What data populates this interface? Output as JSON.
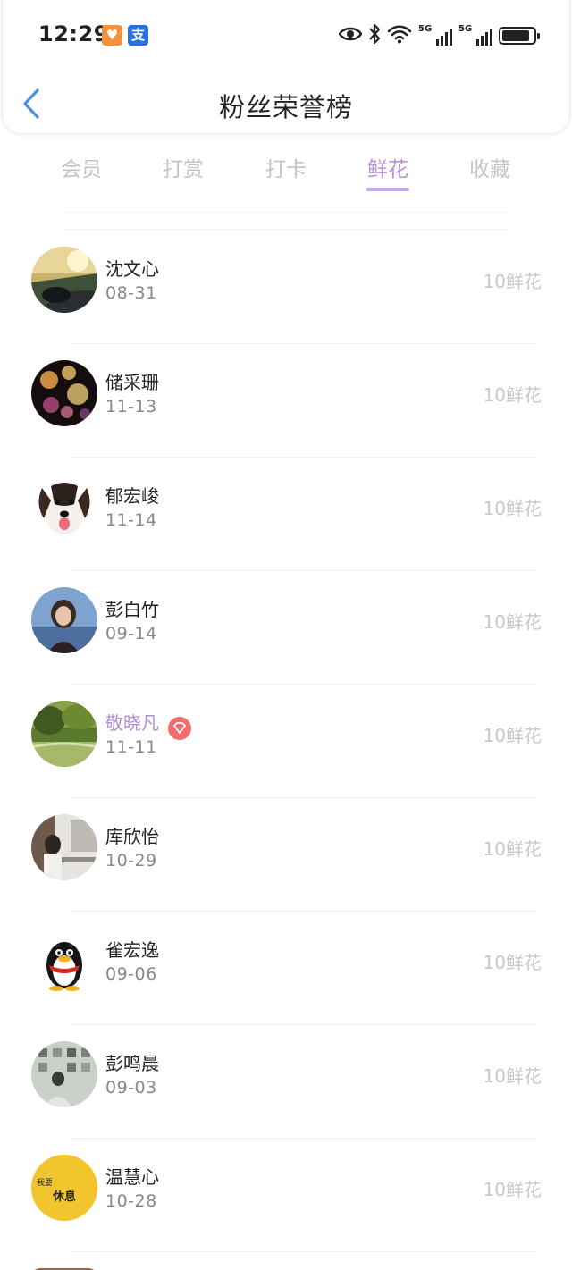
{
  "status_bar": {
    "time": "12:29",
    "app_badges": [
      {
        "name": "shopping-app-icon",
        "glyph": "♥",
        "color": "#f0913c"
      },
      {
        "name": "alipay-icon",
        "glyph": "支",
        "color": "#2b6fe0"
      }
    ],
    "network_labels": [
      "5G",
      "5G"
    ]
  },
  "header": {
    "title": "粉丝荣誉榜",
    "back_icon": "chevron-left-icon",
    "accent_color": "#4a90e2"
  },
  "tabs": [
    {
      "label": "会员",
      "active": false
    },
    {
      "label": "打赏",
      "active": false
    },
    {
      "label": "打卡",
      "active": false
    },
    {
      "label": "鲜花",
      "active": true
    },
    {
      "label": "收藏",
      "active": false
    }
  ],
  "theme": {
    "active_tab_color": "#b692d8",
    "vip_name_color": "#b58ed8",
    "amount_color": "#c8c8c8"
  },
  "fans": [
    {
      "name": "沈文心",
      "date": "08-31",
      "amount": "10鲜花",
      "vip": false,
      "avatar": "car-dashboard-avatar"
    },
    {
      "name": "储采珊",
      "date": "11-13",
      "amount": "10鲜花",
      "vip": false,
      "avatar": "bokeh-lights-avatar"
    },
    {
      "name": "郁宏峻",
      "date": "11-14",
      "amount": "10鲜花",
      "vip": false,
      "avatar": "dog-avatar"
    },
    {
      "name": "彭白竹",
      "date": "09-14",
      "amount": "10鲜花",
      "vip": false,
      "avatar": "girl-portrait-avatar"
    },
    {
      "name": "敬晓凡",
      "date": "11-11",
      "amount": "10鲜花",
      "vip": true,
      "avatar": "green-park-avatar"
    },
    {
      "name": "库欣怡",
      "date": "10-29",
      "amount": "10鲜花",
      "vip": false,
      "avatar": "room-photo-avatar"
    },
    {
      "name": "雀宏逸",
      "date": "09-06",
      "amount": "10鲜花",
      "vip": false,
      "avatar": "penguin-avatar"
    },
    {
      "name": "彭鸣晨",
      "date": "09-03",
      "amount": "10鲜花",
      "vip": false,
      "avatar": "gallery-wall-avatar"
    },
    {
      "name": "温慧心",
      "date": "10-28",
      "amount": "10鲜花",
      "vip": false,
      "avatar": "yellow-rest-avatar",
      "avatar_text": [
        "我要",
        "休息"
      ]
    }
  ]
}
